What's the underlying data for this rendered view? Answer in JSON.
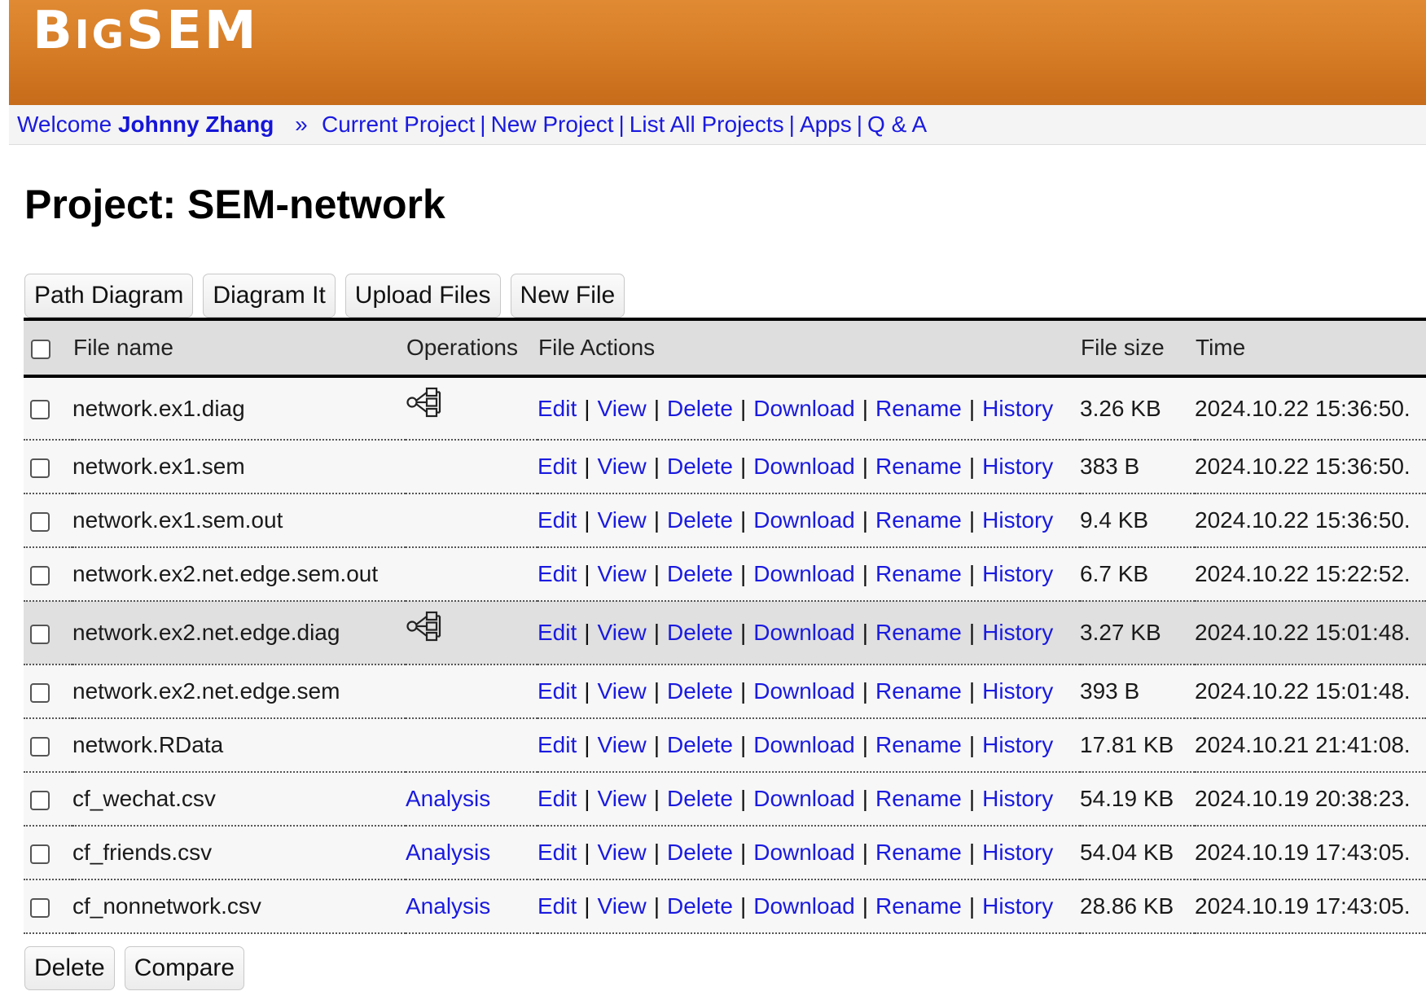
{
  "app": {
    "logo": {
      "initial": "B",
      "small_caps": "IG",
      "rest": "SEM"
    }
  },
  "nav": {
    "welcome_label": "Welcome",
    "user_name": "Johnny Zhang",
    "separator": "»",
    "links": [
      "Current Project",
      "New Project",
      "List All Projects",
      "Apps",
      "Q & A"
    ]
  },
  "page": {
    "title": "Project: SEM-network"
  },
  "toolbar": {
    "path_diagram": "Path Diagram",
    "diagram_it": "Diagram It",
    "upload_files": "Upload Files",
    "new_file": "New File"
  },
  "table": {
    "headers": {
      "file_name": "File name",
      "operations": "Operations",
      "file_actions": "File Actions",
      "file_size": "File size",
      "time": "Time"
    },
    "action_labels": [
      "Edit",
      "View",
      "Delete",
      "Download",
      "Rename",
      "History"
    ],
    "rows": [
      {
        "name": "network.ex1.diag",
        "op": "diagram-icon",
        "size": "3.26 KB",
        "time": "2024.10.22 15:36:50."
      },
      {
        "name": "network.ex1.sem",
        "op": "",
        "size": "383 B",
        "time": "2024.10.22 15:36:50."
      },
      {
        "name": "network.ex1.sem.out",
        "op": "",
        "size": "9.4 KB",
        "time": "2024.10.22 15:36:50."
      },
      {
        "name": "network.ex2.net.edge.sem.out",
        "op": "",
        "size": "6.7 KB",
        "time": "2024.10.22 15:22:52."
      },
      {
        "name": "network.ex2.net.edge.diag",
        "op": "diagram-icon",
        "size": "3.27 KB",
        "time": "2024.10.22 15:01:48.",
        "highlighted": true
      },
      {
        "name": "network.ex2.net.edge.sem",
        "op": "",
        "size": "393 B",
        "time": "2024.10.22 15:01:48."
      },
      {
        "name": "network.RData",
        "op": "",
        "size": "17.81 KB",
        "time": "2024.10.21 21:41:08."
      },
      {
        "name": "cf_wechat.csv",
        "op": "Analysis",
        "size": "54.19 KB",
        "time": "2024.10.19 20:38:23."
      },
      {
        "name": "cf_friends.csv",
        "op": "Analysis",
        "size": "54.04 KB",
        "time": "2024.10.19 17:43:05."
      },
      {
        "name": "cf_nonnetwork.csv",
        "op": "Analysis",
        "size": "28.86 KB",
        "time": "2024.10.19 17:43:05."
      }
    ]
  },
  "bottom": {
    "delete": "Delete",
    "compare": "Compare"
  },
  "colors": {
    "banner": "#d67c26",
    "link": "#1a1adf",
    "header_row": "#dedede"
  }
}
